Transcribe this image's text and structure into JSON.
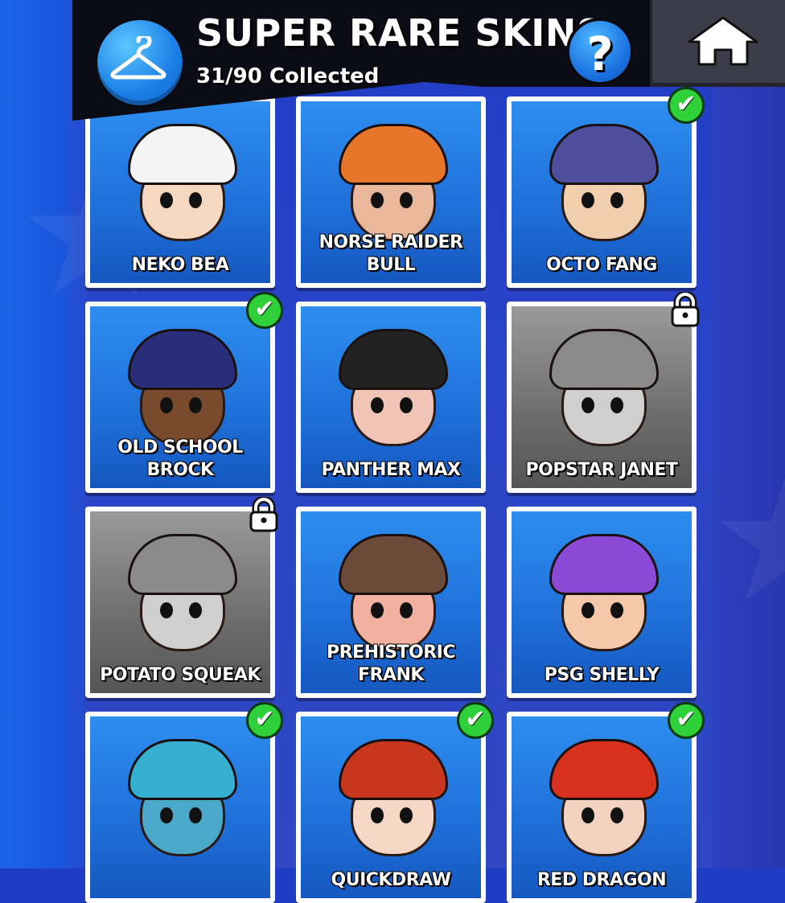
{
  "header": {
    "title": "SUPER RARE SKINS",
    "subtitle": "31/90 Collected",
    "help_label": "?"
  },
  "icons": {
    "badge": "hanger-icon",
    "home": "home-icon",
    "owned": "checkmark-icon",
    "locked": "padlock-icon"
  },
  "colors": {
    "background": "#2a44c8",
    "card_owned": "#1f6fd8",
    "card_locked": "#6d6d6d",
    "check": "#2ed13a"
  },
  "skins": [
    {
      "name": "NEKO BEA",
      "status": "unlocked"
    },
    {
      "name": "NORSE RAIDER\nBULL",
      "status": "unlocked"
    },
    {
      "name": "OCTO FANG",
      "status": "owned"
    },
    {
      "name": "OLD SCHOOL\nBROCK",
      "status": "owned"
    },
    {
      "name": "PANTHER MAX",
      "status": "unlocked"
    },
    {
      "name": "POPSTAR JANET",
      "status": "locked"
    },
    {
      "name": "POTATO SQUEAK",
      "status": "locked"
    },
    {
      "name": "PREHISTORIC\nFRANK",
      "status": "unlocked"
    },
    {
      "name": "PSG SHELLY",
      "status": "unlocked"
    },
    {
      "name": "",
      "status": "owned"
    },
    {
      "name": "QUICKDRAW",
      "status": "owned"
    },
    {
      "name": "RED DRAGON",
      "status": "owned"
    }
  ]
}
